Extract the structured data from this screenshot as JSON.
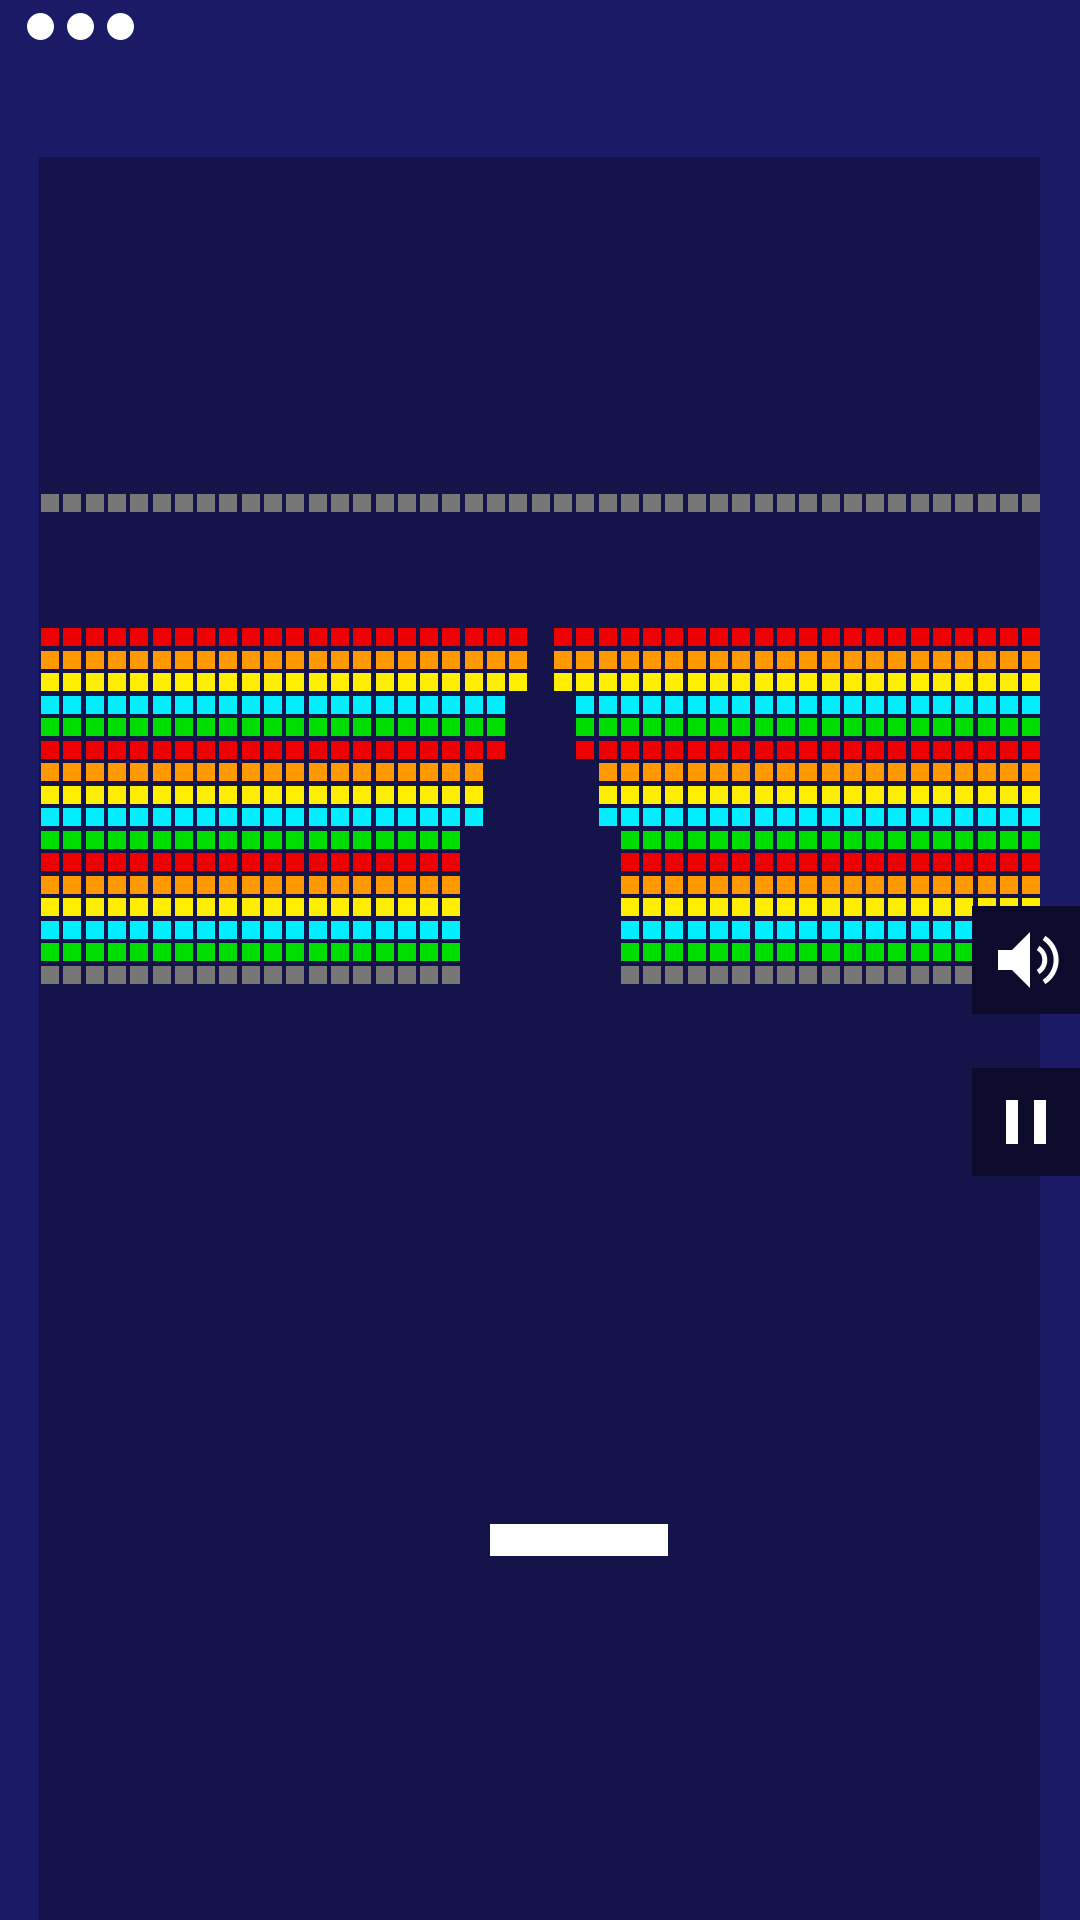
{
  "game": {
    "lives": 3,
    "colors": {
      "background": "#1b1a66",
      "playfield": "#14134a",
      "red": "#ee0000",
      "orange": "#ff9900",
      "yellow": "#ffee00",
      "cyan": "#00eeff",
      "green": "#00dd00",
      "gray": "#777777",
      "paddle": "#ffffff",
      "button": "#0c0b2c"
    },
    "brick_rows": [
      {
        "color": "gray",
        "segments": [
          [
            0,
            45
          ]
        ]
      },
      {
        "color": "red",
        "segments": [
          [
            0,
            22
          ],
          [
            23,
            45
          ]
        ]
      },
      {
        "color": "orange",
        "segments": [
          [
            0,
            22
          ],
          [
            23,
            45
          ]
        ]
      },
      {
        "color": "yellow",
        "segments": [
          [
            0,
            22
          ],
          [
            23,
            45
          ]
        ]
      },
      {
        "color": "cyan",
        "segments": [
          [
            0,
            21
          ],
          [
            24,
            45
          ]
        ]
      },
      {
        "color": "green",
        "segments": [
          [
            0,
            21
          ],
          [
            24,
            45
          ]
        ]
      },
      {
        "color": "red",
        "segments": [
          [
            0,
            21
          ],
          [
            24,
            45
          ]
        ]
      },
      {
        "color": "orange",
        "segments": [
          [
            0,
            20
          ],
          [
            25,
            45
          ]
        ]
      },
      {
        "color": "yellow",
        "segments": [
          [
            0,
            20
          ],
          [
            25,
            45
          ]
        ]
      },
      {
        "color": "cyan",
        "segments": [
          [
            0,
            20
          ],
          [
            25,
            45
          ]
        ]
      },
      {
        "color": "green",
        "segments": [
          [
            0,
            19
          ],
          [
            26,
            45
          ]
        ]
      },
      {
        "color": "red",
        "segments": [
          [
            0,
            19
          ],
          [
            26,
            45
          ]
        ]
      },
      {
        "color": "orange",
        "segments": [
          [
            0,
            19
          ],
          [
            26,
            45
          ]
        ]
      },
      {
        "color": "yellow",
        "segments": [
          [
            0,
            19
          ],
          [
            26,
            45
          ]
        ]
      },
      {
        "color": "cyan",
        "segments": [
          [
            0,
            19
          ],
          [
            26,
            45
          ]
        ]
      },
      {
        "color": "green",
        "segments": [
          [
            0,
            19
          ],
          [
            26,
            45
          ]
        ]
      },
      {
        "color": "gray",
        "segments": [
          [
            0,
            19
          ],
          [
            26,
            45
          ]
        ]
      }
    ],
    "buttons": {
      "sound_icon": "speaker-icon",
      "pause_icon": "pause-icon"
    }
  }
}
